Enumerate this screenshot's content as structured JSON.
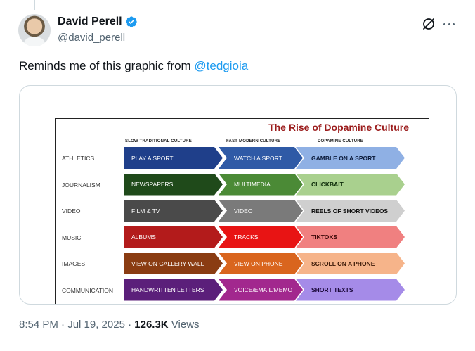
{
  "author": {
    "display_name": "David Perell",
    "handle": "@david_perell",
    "avatar_icon": "avatar-photo",
    "verified_icon": "verified-badge-icon",
    "verified_color": "#1d9bf0"
  },
  "tweet": {
    "text": "Reminds me of this graphic from ",
    "mention": "@tedgioia",
    "timestamp": "8:54 PM · Jul 19, 2025 · ",
    "views_count": "126.3K",
    "views_label": " Views"
  },
  "icons": {
    "grok": "grok-icon",
    "more": "more-options-icon"
  },
  "graphic": {
    "title": "The Rise of Dopamine Culture",
    "column_headers": [
      "SLOW TRADITIONAL CULTURE",
      "FAST MODERN CULTURE",
      "DOPAMINE CULTURE"
    ],
    "rows": [
      {
        "label": "ATHLETICS",
        "cells": [
          "PLAY A SPORT",
          "WATCH A SPORT",
          "GAMBLE ON A SPORT"
        ],
        "colors": [
          "#1f3f8a",
          "#2f5aa6",
          "#8fb0e4"
        ],
        "text_colors": [
          "#ffffff",
          "#ffffff",
          "#0b1a3a"
        ]
      },
      {
        "label": "JOURNALISM",
        "cells": [
          "NEWSPAPERS",
          "MULTIMEDIA",
          "CLICKBAIT"
        ],
        "colors": [
          "#1f4a1a",
          "#4b8a36",
          "#a9d08e"
        ],
        "text_colors": [
          "#ffffff",
          "#ffffff",
          "#0c2a08"
        ]
      },
      {
        "label": "VIDEO",
        "cells": [
          "FILM &  TV",
          "VIDEO",
          "REELS OF SHORT VIDEOS"
        ],
        "colors": [
          "#4a4a4a",
          "#7a7a7a",
          "#cfcfcf"
        ],
        "text_colors": [
          "#ffffff",
          "#ffffff",
          "#111111"
        ]
      },
      {
        "label": "MUSIC",
        "cells": [
          "ALBUMS",
          "TRACKS",
          "TIKTOKS"
        ],
        "colors": [
          "#b31b1b",
          "#e81414",
          "#f08080"
        ],
        "text_colors": [
          "#ffffff",
          "#ffffff",
          "#3a0808"
        ]
      },
      {
        "label": "IMAGES",
        "cells": [
          "VIEW ON GALLERY WALL",
          "VIEW ON PHONE",
          "SCROLL ON A PHONE"
        ],
        "colors": [
          "#8a3c12",
          "#d9651e",
          "#f6b48a"
        ],
        "text_colors": [
          "#ffffff",
          "#ffffff",
          "#3a1806"
        ]
      },
      {
        "label": "COMMUNICATION",
        "cells": [
          "HANDWRITTEN LETTERS",
          "VOICE/EMAIL/MEMO",
          "SHORT TEXTS"
        ],
        "colors": [
          "#5b1f7a",
          "#a2288e",
          "#a58be8"
        ],
        "text_colors": [
          "#ffffff",
          "#ffffff",
          "#1a0838"
        ]
      }
    ]
  }
}
